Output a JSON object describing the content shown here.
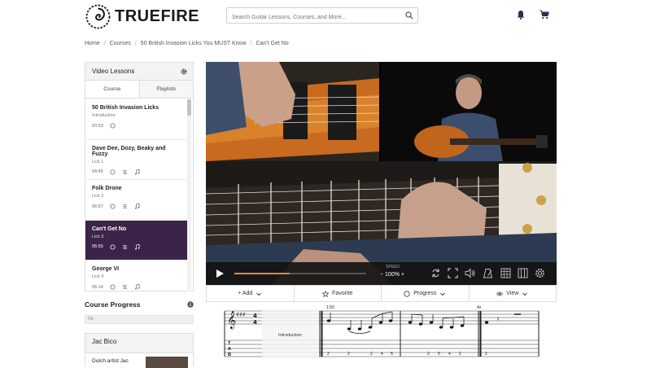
{
  "header": {
    "brand": "TRUEFIRE",
    "search_placeholder": "Search Guitar Lessons, Courses, and More...",
    "icons": [
      "bell-icon",
      "cart-icon"
    ],
    "accent": "#3b2449"
  },
  "breadcrumb": [
    "Home",
    "Courses",
    "50 British Invasion Licks You MUST Know",
    "Can't Get No"
  ],
  "sidebar": {
    "title": "Video Lessons",
    "tabs": [
      "Course",
      "Playlists"
    ],
    "lessons": [
      {
        "title": "50 British Invasion Licks",
        "sub": "Introduction",
        "time": "03:53"
      },
      {
        "title": "Dave Dee, Dozy, Beaky and Fuzzy",
        "sub": "Lick 1",
        "time": "04:45"
      },
      {
        "title": "Folk Drone",
        "sub": "Lick 2",
        "time": "06:57"
      },
      {
        "title": "Can't Get No",
        "sub": "Lick 3",
        "time": "05:55"
      },
      {
        "title": "George VI",
        "sub": "Lick 4",
        "time": "05:14"
      }
    ]
  },
  "course_progress": {
    "title": "Course Progress",
    "value": "0%"
  },
  "instructor": {
    "name": "Jac Bico",
    "bio": "Dutch artist Jac"
  },
  "player": {
    "speed_label": "SPEED",
    "speed_value": "− 100% +",
    "progress_fraction": 0.42
  },
  "actions": [
    "+ Add",
    "Favorite",
    "Progress",
    "View"
  ],
  "notation": {
    "section": "Introduction",
    "tempo_mark": "1:50",
    "repeat_mark": "4x",
    "tab_numbers": [
      "2",
      "2",
      "2",
      "4",
      "5",
      "2",
      "5",
      "4",
      "2",
      "2"
    ]
  }
}
